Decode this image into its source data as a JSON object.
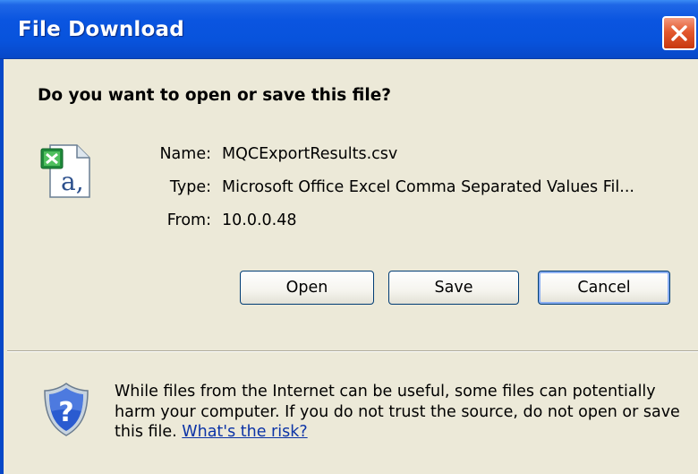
{
  "window": {
    "title": "File Download",
    "question": "Do you want to open or save this file?"
  },
  "file_info": {
    "name_label": "Name:",
    "name_value": "MQCExportResults.csv",
    "type_label": "Type:",
    "type_value": "Microsoft Office Excel Comma Separated Values Fil...",
    "from_label": "From:",
    "from_value": "10.0.0.48"
  },
  "buttons": {
    "open": "Open",
    "save": "Save",
    "cancel": "Cancel"
  },
  "warning": {
    "text": "While files from the Internet can be useful, some files can potentially harm your computer. If you do not trust the source, do not open or save this file.",
    "link": "What's the risk?"
  },
  "icons": {
    "file": "excel-csv-file-icon",
    "shield": "security-shield-icon",
    "close": "close-icon"
  },
  "colors": {
    "titlebar": "#0853dc",
    "close_button": "#e3592f",
    "dialog_bg": "#ece9d8",
    "link": "#0b33a6"
  }
}
